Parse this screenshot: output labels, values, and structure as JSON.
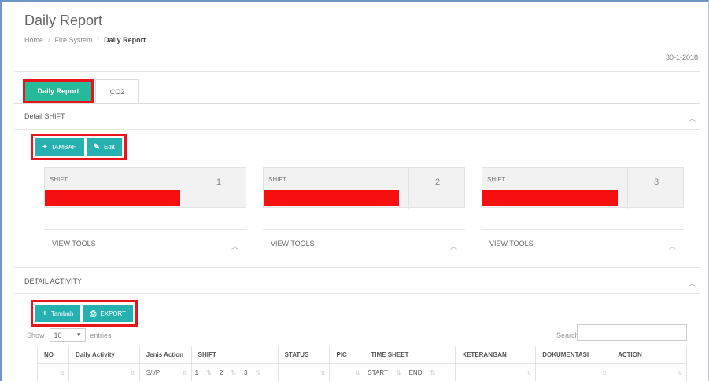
{
  "header": {
    "title": "Daily Report",
    "breadcrumb": [
      "Home",
      "Fire System",
      "Daily Report"
    ],
    "date": "30-1-2018"
  },
  "tabs": [
    {
      "label": "Daily Report",
      "active": true
    },
    {
      "label": "CO2",
      "active": false
    }
  ],
  "detail_shift": {
    "title": "Detail SHIFT",
    "buttons": [
      {
        "icon": "+",
        "label": "TAMBAH"
      },
      {
        "icon": "✎",
        "label": "Edit"
      }
    ],
    "shifts": [
      {
        "label": "SHIFT",
        "number": "1",
        "tools": "VIEW TOOLS"
      },
      {
        "label": "SHIFT",
        "number": "2",
        "tools": "VIEW TOOLS"
      },
      {
        "label": "SHIFT",
        "number": "3",
        "tools": "VIEW TOOLS"
      }
    ]
  },
  "detail_activity": {
    "title": "DETAIL ACTIVITY",
    "buttons": [
      {
        "icon": "+",
        "label": "Tambah"
      },
      {
        "icon": "⎙",
        "label": "EXPORT"
      }
    ],
    "show_label": "Show",
    "entries_value": "10",
    "entries_label": "entries",
    "search_label": "Search:",
    "columns": [
      "NO",
      "Daily Activity",
      "Jenis Action",
      "SHIFT",
      "STATUS",
      "PIC",
      "TIME SHEET",
      "KETERANGAN",
      "DOKUMENTASI",
      "ACTION"
    ],
    "sub_columns": {
      "jenis_action": "S/I/P",
      "shift": [
        "1",
        "2",
        "3"
      ],
      "time_sheet": [
        "START",
        "END"
      ]
    }
  },
  "colors": {
    "accent_green": "#26b99a",
    "button_teal": "#26b0b0",
    "highlight_red": "#e8131b"
  }
}
